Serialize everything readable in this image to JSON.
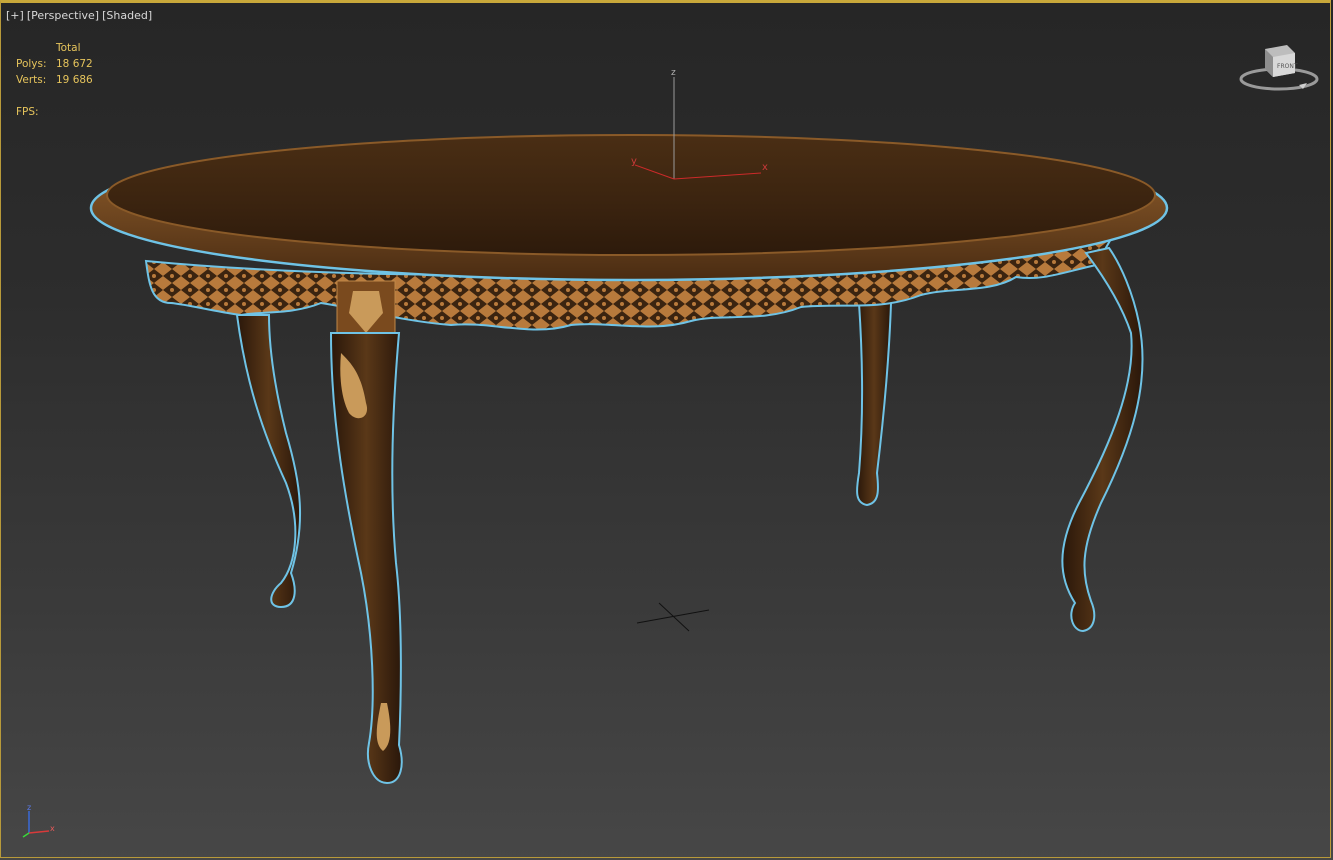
{
  "viewport": {
    "label_parts": [
      "[+]",
      "[Perspective]",
      "[Shaded]"
    ]
  },
  "stats": {
    "header": "Total",
    "polys_label": "Polys:",
    "polys_value": "18 672",
    "verts_label": "Verts:",
    "verts_value": "19 686",
    "fps_label": "FPS:"
  },
  "gizmo": {
    "x_label": "x",
    "y_label": "y",
    "z_label": "z"
  },
  "viewcube": {
    "face_label": "FRONT"
  },
  "tripod": {
    "x_label": "x",
    "z_label": "z"
  },
  "colors": {
    "viewport_border": "#c8a83a",
    "stats_text": "#e6c45c",
    "selection_outline": "#6fc3e6",
    "wood_dark": "#3b2410",
    "wood_light": "#b87a3c"
  }
}
